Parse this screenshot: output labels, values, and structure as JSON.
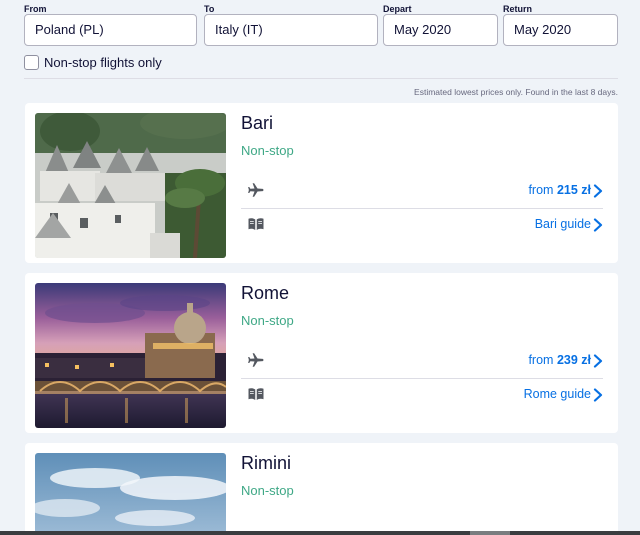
{
  "search": {
    "from": {
      "label": "From",
      "value": "Poland (PL)"
    },
    "to": {
      "label": "To",
      "value": "Italy (IT)"
    },
    "depart": {
      "label": "Depart",
      "value": "May 2020"
    },
    "return": {
      "label": "Return",
      "value": "May 2020"
    },
    "nonstop_only_label": "Non-stop flights only",
    "nonstop_only_checked": false
  },
  "disclaimer": "Estimated lowest prices only. Found in the last 8 days.",
  "destinations": [
    {
      "city": "Bari",
      "stops": "Non-stop",
      "price_prefix": "from",
      "price": "215 zł",
      "guide_label": "Bari guide",
      "image": "trulli-houses-photo"
    },
    {
      "city": "Rome",
      "stops": "Non-stop",
      "price_prefix": "from",
      "price": "239 zł",
      "guide_label": "Rome guide",
      "image": "vatican-dusk-photo"
    },
    {
      "city": "Rimini",
      "stops": "Non-stop",
      "image": "rimini-sky-photo"
    }
  ],
  "icons": {
    "flight": "plane-icon",
    "guide": "book-icon",
    "link": "chevron-right-icon"
  },
  "colors": {
    "accent": "#0770e3",
    "nonstop": "#3fa886",
    "background": "#eff3f8"
  }
}
